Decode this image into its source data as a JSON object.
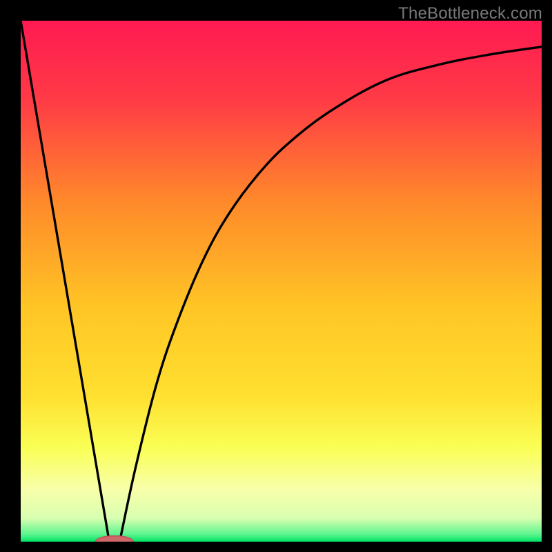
{
  "watermark": "TheBottleneck.com",
  "colors": {
    "background": "#000000",
    "gradient_top": "#ff1a52",
    "gradient_mid_upper": "#ff8a2a",
    "gradient_mid": "#ffe030",
    "gradient_lower": "#faff55",
    "gradient_band": "#f8ffaa",
    "gradient_bottom": "#00e565",
    "curve": "#000000",
    "marker_fill": "#d06a6a",
    "marker_stroke": "#c05a5a"
  },
  "chart_data": {
    "type": "line",
    "title": "",
    "xlabel": "",
    "ylabel": "",
    "xlim": [
      0,
      100
    ],
    "ylim": [
      0,
      100
    ],
    "series": [
      {
        "name": "left-branch",
        "x": [
          0,
          17
        ],
        "values": [
          100,
          0
        ]
      },
      {
        "name": "right-branch",
        "x": [
          19,
          22,
          26,
          30,
          35,
          40,
          46,
          52,
          60,
          70,
          80,
          90,
          100
        ],
        "values": [
          0,
          14,
          30,
          42,
          54,
          63,
          71,
          77,
          83,
          88.5,
          91.5,
          93.5,
          95
        ]
      }
    ],
    "marker": {
      "x": 18,
      "y": 0,
      "rx": 3.6,
      "ry": 1.1
    },
    "gradient_stops": [
      {
        "offset": 0.0,
        "color": "#ff1a52"
      },
      {
        "offset": 0.15,
        "color": "#ff3a46"
      },
      {
        "offset": 0.35,
        "color": "#ff8a2a"
      },
      {
        "offset": 0.55,
        "color": "#ffc525"
      },
      {
        "offset": 0.72,
        "color": "#ffe030"
      },
      {
        "offset": 0.82,
        "color": "#faff55"
      },
      {
        "offset": 0.9,
        "color": "#f8ffaa"
      },
      {
        "offset": 0.955,
        "color": "#d8ffb0"
      },
      {
        "offset": 0.985,
        "color": "#60f590"
      },
      {
        "offset": 1.0,
        "color": "#00e565"
      }
    ]
  }
}
